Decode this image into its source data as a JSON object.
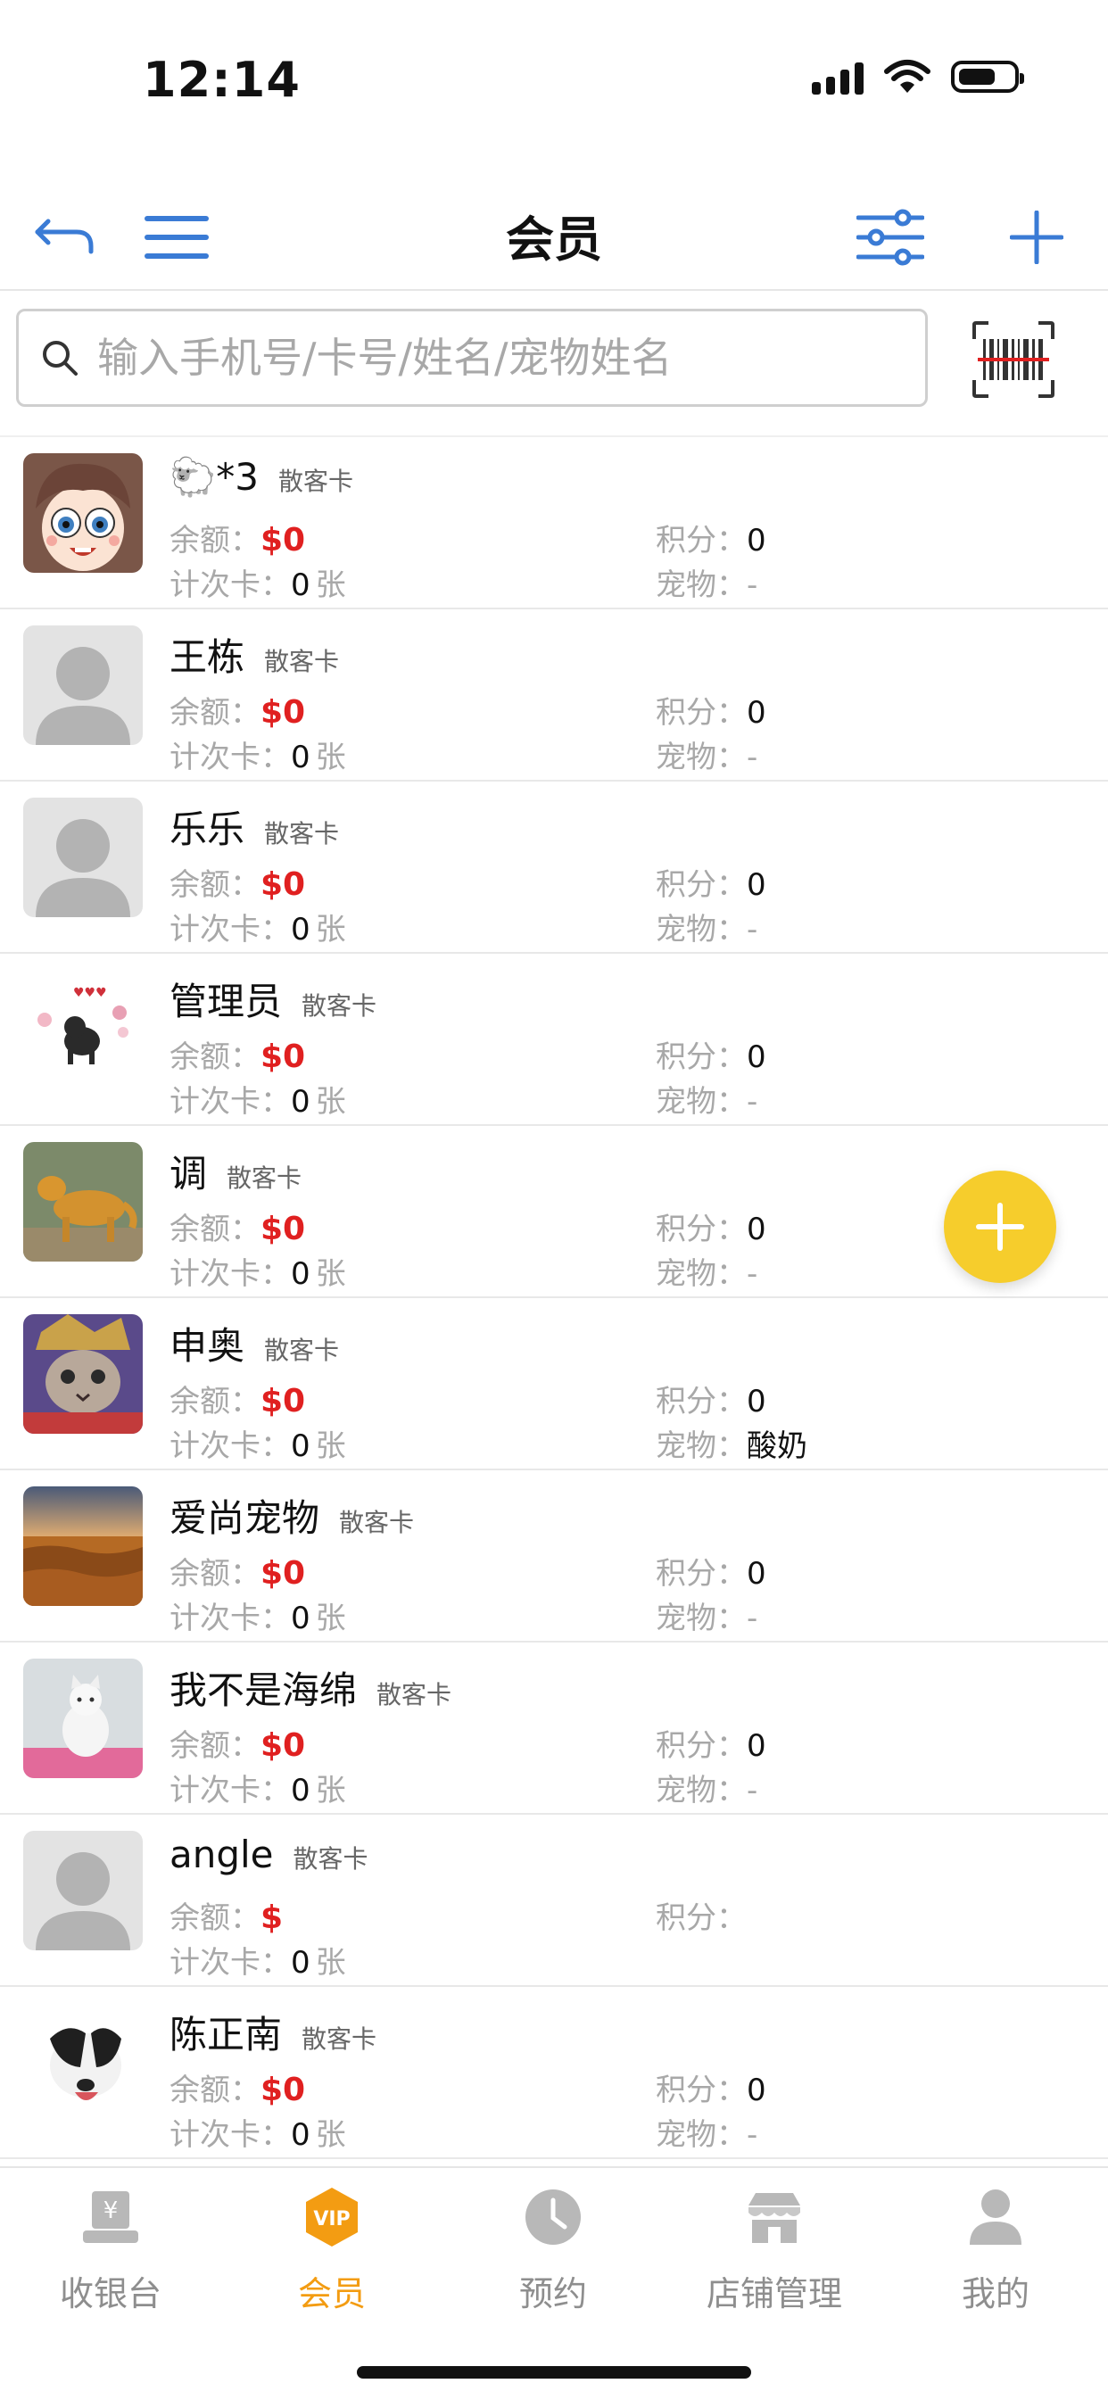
{
  "status_bar": {
    "time": "12:14"
  },
  "header": {
    "title": "会员"
  },
  "search": {
    "placeholder": "输入手机号/卡号/姓名/宠物姓名"
  },
  "labels": {
    "balance": "余额：",
    "count_card": "计次卡：",
    "points": "积分：",
    "pet": "宠物：",
    "unit": "张"
  },
  "members": [
    {
      "name": "🐑*3",
      "card_type": "散客卡",
      "balance": "$0",
      "count_card": "0",
      "points": "0",
      "pet": "-",
      "avatar": "cartoon-girl"
    },
    {
      "name": "王栋",
      "card_type": "散客卡",
      "balance": "$0",
      "count_card": "0",
      "points": "0",
      "pet": "-",
      "avatar": "default"
    },
    {
      "name": "乐乐",
      "card_type": "散客卡",
      "balance": "$0",
      "count_card": "0",
      "points": "0",
      "pet": "-",
      "avatar": "default"
    },
    {
      "name": "管理员",
      "card_type": "散客卡",
      "balance": "$0",
      "count_card": "0",
      "points": "0",
      "pet": "-",
      "avatar": "black-dog"
    },
    {
      "name": "调",
      "card_type": "散客卡",
      "balance": "$0",
      "count_card": "0",
      "points": "0",
      "pet": "-",
      "avatar": "golden-retriever"
    },
    {
      "name": "申奥",
      "card_type": "散客卡",
      "balance": "$0",
      "count_card": "0",
      "points": "0",
      "pet": "酸奶",
      "avatar": "cat-costume"
    },
    {
      "name": "爱尚宠物",
      "card_type": "散客卡",
      "balance": "$0",
      "count_card": "0",
      "points": "0",
      "pet": "-",
      "avatar": "wheat-field"
    },
    {
      "name": "我不是海绵",
      "card_type": "散客卡",
      "balance": "$0",
      "count_card": "0",
      "points": "0",
      "pet": "-",
      "avatar": "white-cat"
    },
    {
      "name": "angle",
      "card_type": "散客卡",
      "balance": "$",
      "count_card": "0",
      "points": "",
      "pet": null,
      "avatar": "default"
    },
    {
      "name": "陈正南",
      "card_type": "散客卡",
      "balance": "$0",
      "count_card": "0",
      "points": "0",
      "pet": "-",
      "avatar": "border-collie"
    }
  ],
  "tabs": [
    {
      "label": "收银台",
      "icon": "cashier-icon",
      "active": false
    },
    {
      "label": "会员",
      "icon": "vip-icon",
      "active": true
    },
    {
      "label": "预约",
      "icon": "clock-icon",
      "active": false
    },
    {
      "label": "店铺管理",
      "icon": "store-icon",
      "active": false
    },
    {
      "label": "我的",
      "icon": "user-icon",
      "active": false
    }
  ],
  "colors": {
    "accent_blue": "#3a7bd5",
    "money_red": "#e02020",
    "fab_yellow": "#f6cd2c",
    "active_tab": "#f39c12",
    "inactive": "#8e8e8e"
  }
}
